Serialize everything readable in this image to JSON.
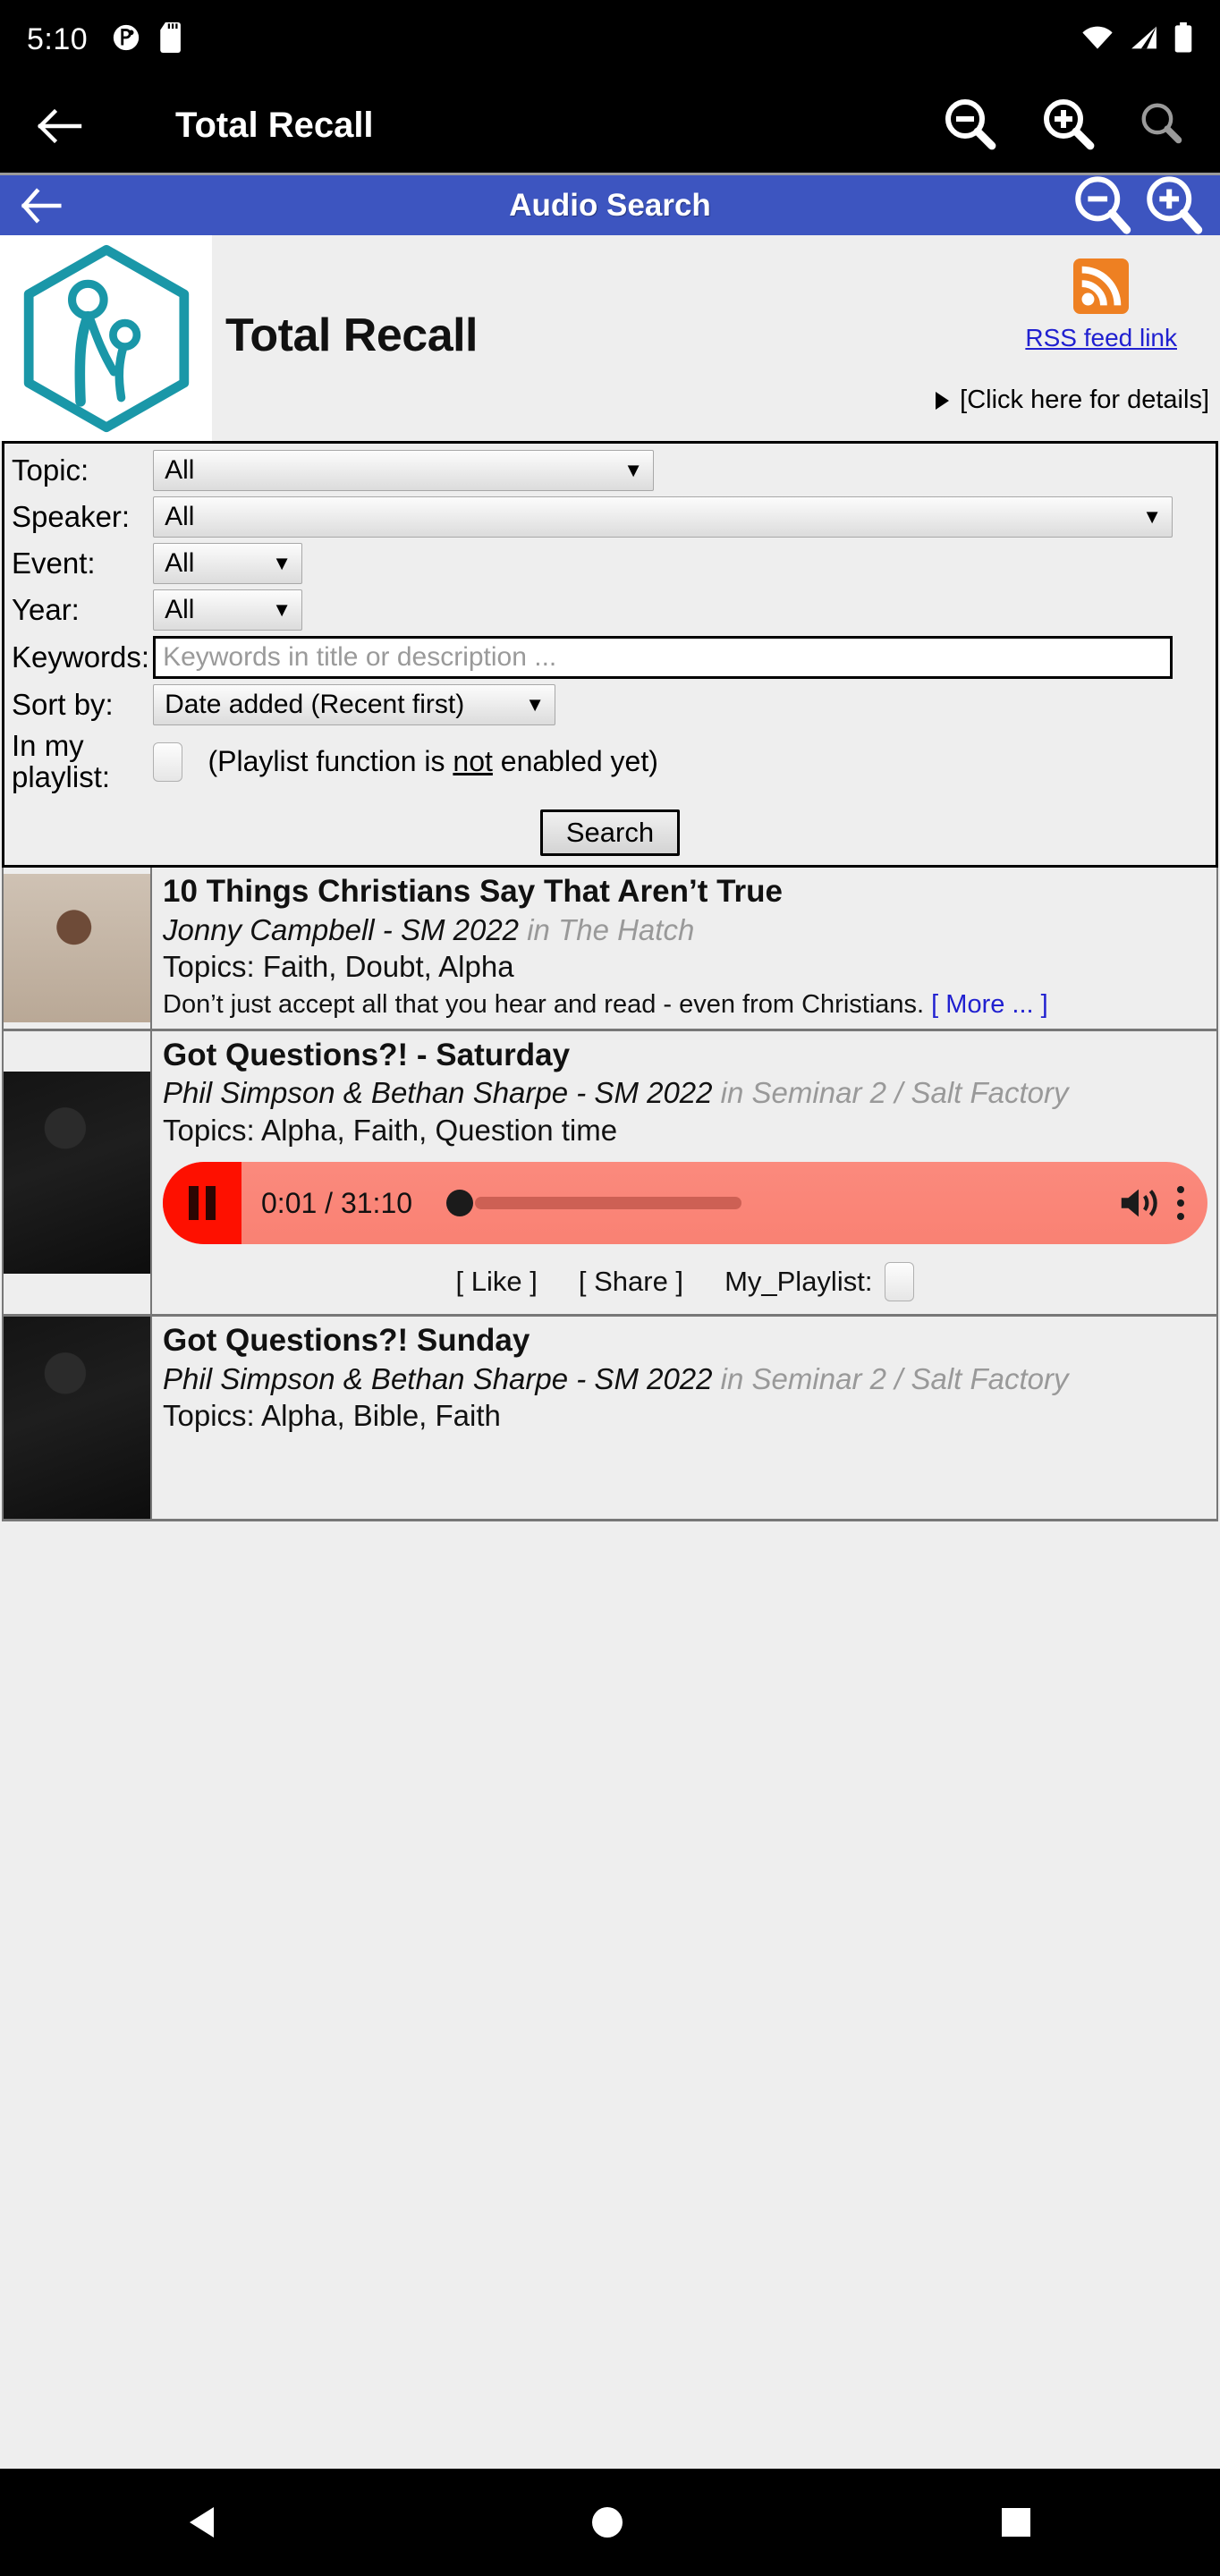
{
  "status_bar": {
    "time": "5:10",
    "icons": [
      "do-not-disturb-icon",
      "sd-card-icon"
    ],
    "right_icons": [
      "wifi-icon",
      "cellular-signal-icon",
      "battery-icon"
    ]
  },
  "app_bar": {
    "back_icon": "back-arrow-icon",
    "title": "Total Recall",
    "actions": [
      "zoom-out-icon",
      "zoom-in-icon",
      "search-icon"
    ]
  },
  "blue_bar": {
    "back_icon": "back-arrow-icon",
    "title": "Audio Search",
    "actions": [
      "zoom-out-icon",
      "zoom-in-icon"
    ],
    "color": "#3d55c0"
  },
  "site_header": {
    "logo_alt": "total-recall-logo",
    "logo_color": "#1a97a8",
    "title": "Total Recall",
    "rss_icon": "rss-icon",
    "rss_icon_color": "#ee8022",
    "rss_label": "RSS feed link",
    "details_marker": "disclosure-triangle-icon",
    "details_label": "[Click here for details]"
  },
  "search_form": {
    "topic": {
      "label": "Topic:",
      "value": "All"
    },
    "speaker": {
      "label": "Speaker:",
      "value": "All"
    },
    "event": {
      "label": "Event:",
      "value": "All"
    },
    "year": {
      "label": "Year:",
      "value": "All"
    },
    "keywords": {
      "label": "Keywords:",
      "value": "",
      "placeholder": "Keywords in title or description ..."
    },
    "sort_by": {
      "label": "Sort by:",
      "value": "Date added (Recent first)"
    },
    "playlist": {
      "label_line1": "In my",
      "label_line2": "playlist:",
      "checked": false,
      "note_before": "(Playlist function is ",
      "note_underlined": "not",
      "note_after": " enabled yet)"
    },
    "search_button": "Search"
  },
  "results": [
    {
      "title": "10 Things Christians Say That Aren’t True",
      "speaker": "Jonny Campbell - SM 2022",
      "in_word": " in ",
      "venue": "The Hatch",
      "topics": "Topics: Faith, Doubt, Alpha",
      "description": "Don’t just accept all that you hear and read - even from Christians.",
      "more_link": "[ More ... ]",
      "thumbnail": "speaker-portrait-thumbnail",
      "has_player": false
    },
    {
      "title": "Got Questions?! - Saturday",
      "speaker": "Phil Simpson & Bethan Sharpe - SM 2022",
      "in_word": " in ",
      "venue": "Seminar 2 / Salt Factory",
      "topics": "Topics: Alpha, Faith, Question time",
      "thumbnail": "stage-photo-thumbnail",
      "has_player": true,
      "player": {
        "state": "playing",
        "play_pause_icon": "pause-icon",
        "time_display": "0:01 / 31:10",
        "current_time": "0:01",
        "duration": "31:10",
        "progress_percent": 0.05,
        "volume_icon": "volume-up-icon",
        "menu_icon": "more-vertical-icon",
        "bar_color": "#fa8578",
        "button_color": "#fe1000"
      },
      "actions": {
        "like": "[ Like ]",
        "share": "[ Share ]",
        "playlist_label": "My_Playlist:",
        "playlist_checked": false
      }
    },
    {
      "title": "Got Questions?! Sunday",
      "speaker": "Phil Simpson & Bethan Sharpe - SM 2022",
      "in_word": " in ",
      "venue": "Seminar 2 / Salt Factory",
      "topics": "Topics: Alpha, Bible, Faith",
      "thumbnail": "stage-photo-thumbnail",
      "has_player": false
    }
  ],
  "nav_bar": {
    "back": "nav-back-icon",
    "home": "nav-home-icon",
    "recents": "nav-recents-icon"
  }
}
